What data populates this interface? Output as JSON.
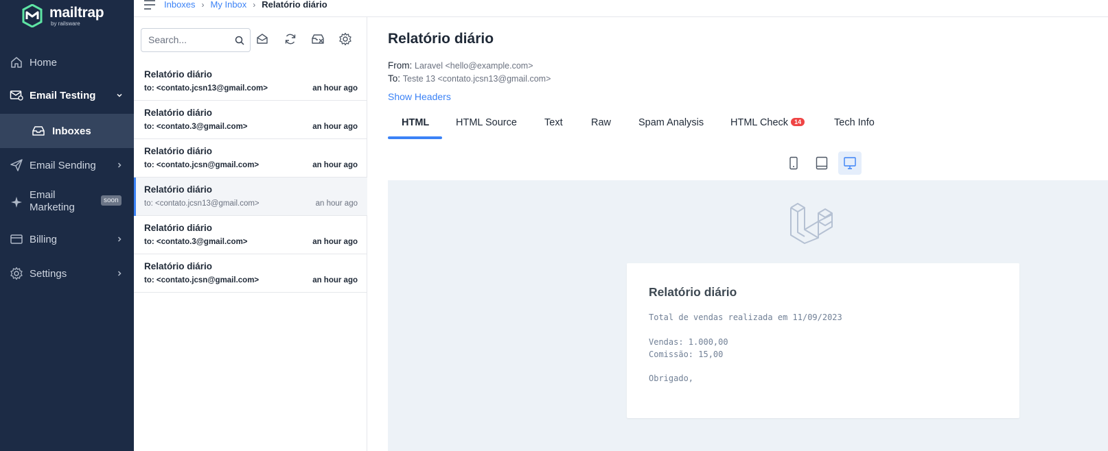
{
  "sidebar": {
    "logo_name": "mailtrap",
    "logo_sub": "by railsware",
    "items": [
      {
        "label": "Home"
      },
      {
        "label": "Email Testing"
      },
      {
        "label": "Inboxes"
      },
      {
        "label": "Email Sending"
      },
      {
        "label": "Email\nMarketing",
        "badge": "soon"
      },
      {
        "label": "Billing"
      },
      {
        "label": "Settings"
      }
    ],
    "marketing_line1": "Email",
    "marketing_line2": "Marketing"
  },
  "breadcrumb": {
    "items": [
      "Inboxes",
      "My Inbox",
      "Relatório diário"
    ],
    "separator": "›"
  },
  "list": {
    "search_placeholder": "Search...",
    "messages": [
      {
        "subject": "Relatório diário",
        "to": "to: <contato.jcsn13@gmail.com>",
        "time": "an hour ago"
      },
      {
        "subject": "Relatório diário",
        "to": "to: <contato.3@gmail.com>",
        "time": "an hour ago"
      },
      {
        "subject": "Relatório diário",
        "to": "to: <contato.jcsn@gmail.com>",
        "time": "an hour ago"
      },
      {
        "subject": "Relatório diário",
        "to": "to: <contato.jcsn13@gmail.com>",
        "time": "an hour ago"
      },
      {
        "subject": "Relatório diário",
        "to": "to: <contato.3@gmail.com>",
        "time": "an hour ago"
      },
      {
        "subject": "Relatório diário",
        "to": "to: <contato.jcsn@gmail.com>",
        "time": "an hour ago"
      }
    ]
  },
  "detail": {
    "title": "Relatório diário",
    "from_label": "From:",
    "from_value": "Laravel <hello@example.com>",
    "to_label": "To:",
    "to_value": "Teste 13 <contato.jcsn13@gmail.com>",
    "show_headers": "Show Headers",
    "tabs": [
      "HTML",
      "HTML Source",
      "Text",
      "Raw",
      "Spam Analysis",
      "HTML Check",
      "Tech Info"
    ],
    "html_check_count": "14"
  },
  "email_body": {
    "heading": "Relatório diário",
    "line1": "Total de vendas realizada em 11/09/2023",
    "line2": "Vendas: 1.000,00",
    "line3": "Comissão: 15,00",
    "line4": "Obrigado,"
  },
  "colors": {
    "sidebar_bg": "#1c2b45",
    "accent": "#3b82f6",
    "badge_red": "#ef4444",
    "preview_bg": "#edf2f7"
  }
}
